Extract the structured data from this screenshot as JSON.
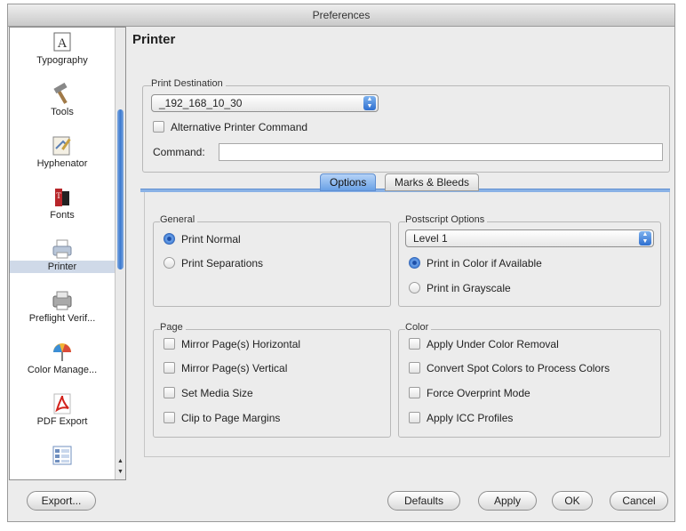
{
  "window": {
    "title": "Preferences"
  },
  "sidebar": {
    "items": [
      {
        "label": "Typography",
        "icon": "typography-icon",
        "selected": false
      },
      {
        "label": "Tools",
        "icon": "hammer-icon",
        "selected": false
      },
      {
        "label": "Hyphenator",
        "icon": "hyphenator-icon",
        "selected": false
      },
      {
        "label": "Fonts",
        "icon": "fonts-icon",
        "selected": false
      },
      {
        "label": "Printer",
        "icon": "printer-icon",
        "selected": true
      },
      {
        "label": "Preflight Verif...",
        "icon": "preflight-icon",
        "selected": false
      },
      {
        "label": "Color Manage...",
        "icon": "umbrella-icon",
        "selected": false
      },
      {
        "label": "PDF Export",
        "icon": "pdf-icon",
        "selected": false
      },
      {
        "label": "",
        "icon": "grid-icon",
        "selected": false
      }
    ]
  },
  "page": {
    "title": "Printer"
  },
  "print_destination": {
    "label": "Print Destination",
    "value": "_192_168_10_30",
    "alt_command_label": "Alternative Printer Command",
    "alt_command_checked": false,
    "command_label": "Command:",
    "command_value": ""
  },
  "tabs": [
    {
      "label": "Options",
      "active": true
    },
    {
      "label": "Marks & Bleeds",
      "active": false
    }
  ],
  "general": {
    "label": "General",
    "options": [
      {
        "label": "Print Normal",
        "selected": true
      },
      {
        "label": "Print Separations",
        "selected": false
      }
    ]
  },
  "postscript": {
    "label": "Postscript Options",
    "level": "Level 1",
    "options": [
      {
        "label": "Print in Color if Available",
        "selected": true
      },
      {
        "label": "Print in Grayscale",
        "selected": false
      }
    ]
  },
  "page_group": {
    "label": "Page",
    "options": [
      {
        "label": "Mirror Page(s) Horizontal",
        "checked": false
      },
      {
        "label": "Mirror Page(s) Vertical",
        "checked": false
      },
      {
        "label": "Set Media Size",
        "checked": false
      },
      {
        "label": "Clip to Page Margins",
        "checked": false
      }
    ]
  },
  "color_group": {
    "label": "Color",
    "options": [
      {
        "label": "Apply Under Color Removal",
        "checked": false
      },
      {
        "label": "Convert Spot Colors to Process Colors",
        "checked": false
      },
      {
        "label": "Force Overprint Mode",
        "checked": false
      },
      {
        "label": "Apply ICC Profiles",
        "checked": false
      }
    ]
  },
  "buttons": {
    "export": "Export...",
    "defaults": "Defaults",
    "apply": "Apply",
    "ok": "OK",
    "cancel": "Cancel"
  },
  "colors": {
    "accent": "#3a79d0",
    "window_bg": "#ececec",
    "selection": "#cfd9e8"
  }
}
